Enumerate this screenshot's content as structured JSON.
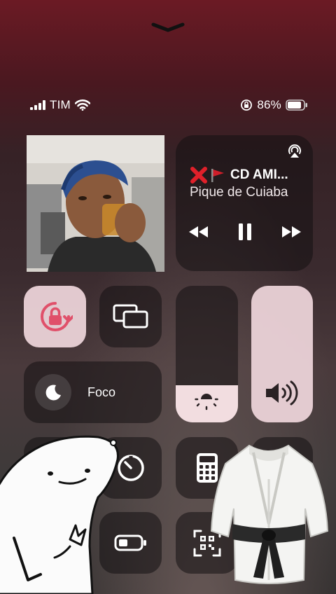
{
  "status": {
    "carrier": "TIM",
    "battery_percent": "86%",
    "battery_level": 0.86,
    "signal_bars": 4
  },
  "media": {
    "title": "CD AMI...",
    "subtitle": "Pique de Cuiaba",
    "state": "paused"
  },
  "focus": {
    "label": "Foco"
  },
  "sliders": {
    "brightness_level": 0.27,
    "volume_level": 1.0
  },
  "colors": {
    "accent_pink": "#e0506a",
    "tile_dark": "#1a1416",
    "tile_light": "#f2dde0"
  },
  "icons": {
    "chevron": "chevron-down-icon",
    "wifi": "wifi-icon",
    "rotation_lock": "rotation-lock-icon",
    "screen_mirroring": "screen-mirroring-icon",
    "focus": "moon-icon",
    "brightness": "sun-icon",
    "volume": "speaker-icon",
    "timer": "timer-icon",
    "calculator": "calculator-icon",
    "battery_mode": "low-power-icon",
    "qr": "qr-scanner-icon",
    "airplay": "airplay-icon"
  }
}
